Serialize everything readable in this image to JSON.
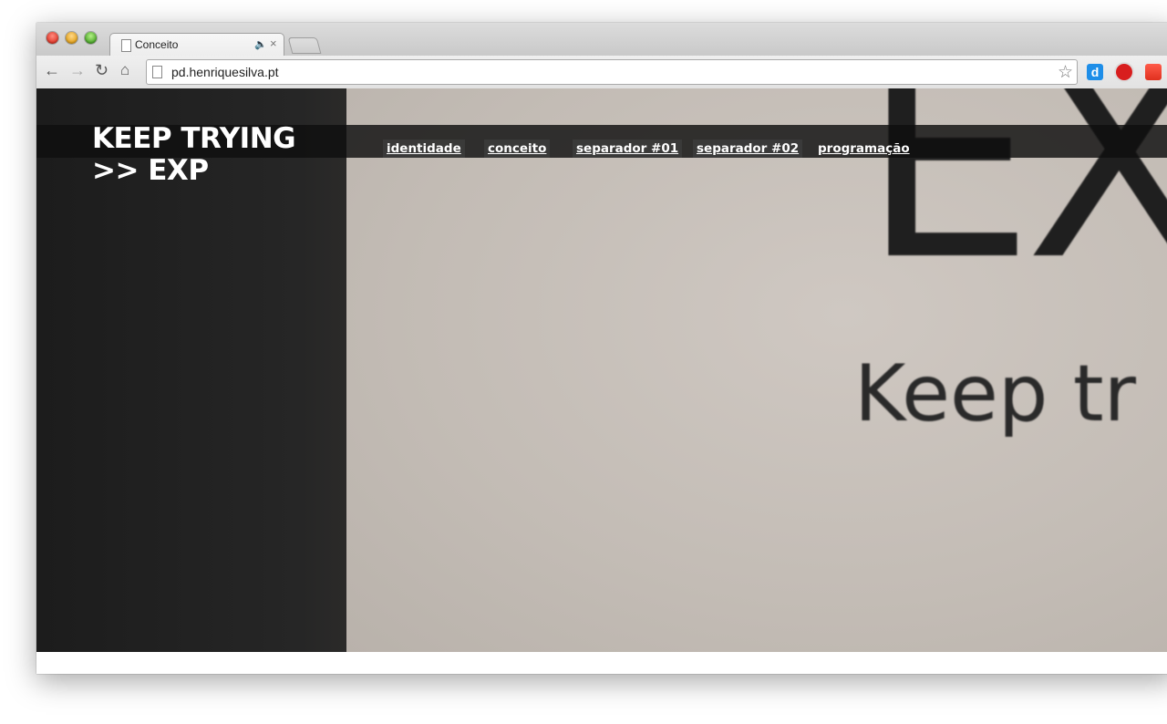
{
  "browser": {
    "tab": {
      "title": "Conceito",
      "audio_icon": "speaker-icon",
      "close": "×"
    },
    "address": {
      "url": "pd.henriquesilva.pt"
    },
    "nav": {
      "back": "←",
      "forward": "→",
      "reload": "↻",
      "home": "⌂"
    },
    "star": "☆",
    "extensions": [
      {
        "name": "d-extension-icon",
        "glyph": "d"
      },
      {
        "name": "stop-extension-icon"
      },
      {
        "name": "bookmark-extension-icon"
      }
    ]
  },
  "page": {
    "site_title": "KEEP TRYING >> EXP",
    "menu": [
      "identidade",
      "conceito",
      "separador #01",
      "separador #02",
      "programação"
    ],
    "photo_text_big": "EX",
    "photo_text_sub": "Keep tr"
  }
}
